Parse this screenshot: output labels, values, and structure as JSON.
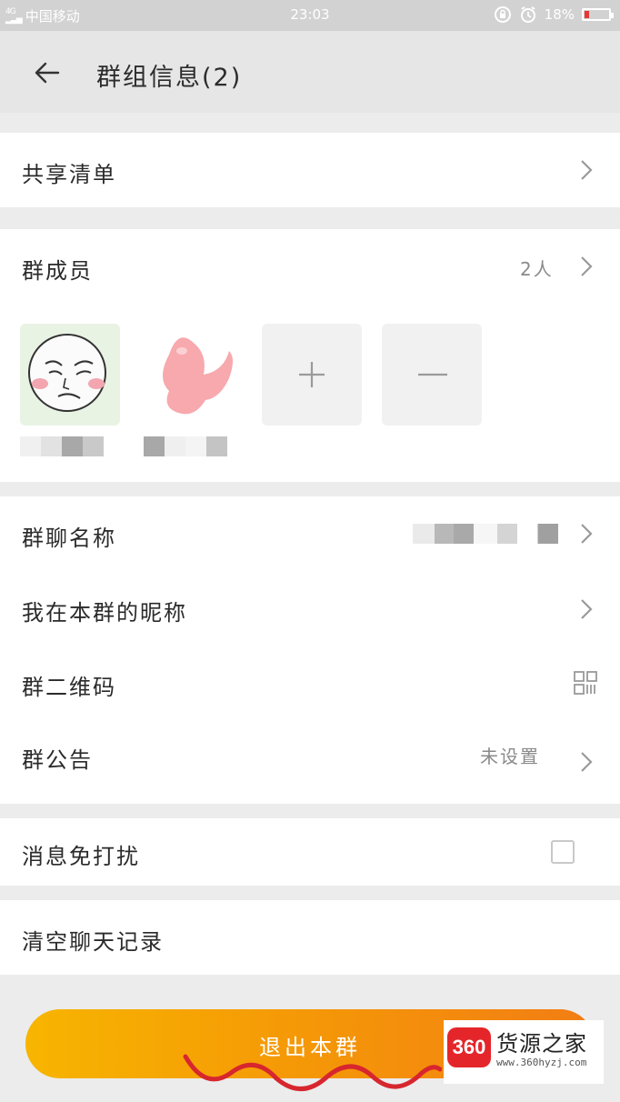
{
  "status_bar": {
    "carrier": "中国移动",
    "network": "4G",
    "time": "23:03",
    "battery": "18%",
    "battery_level": 0.18
  },
  "header": {
    "title": "群组信息(2)"
  },
  "sections": {
    "shared_list": {
      "label": "共享清单"
    },
    "members": {
      "label": "群成员",
      "count": "2人"
    },
    "group_name": {
      "label": "群聊名称"
    },
    "my_nickname": {
      "label": "我在本群的昵称"
    },
    "qr_code": {
      "label": "群二维码"
    },
    "announcement": {
      "label": "群公告",
      "value": "未设置"
    },
    "mute": {
      "label": "消息免打扰",
      "checked": false
    },
    "clear_history": {
      "label": "清空聊天记录"
    }
  },
  "member_actions": {
    "add": "+",
    "remove": "—"
  },
  "exit_button": {
    "label": "退出本群"
  },
  "watermark": {
    "logo": "360",
    "brand": "货源之家",
    "url": "www.360hyzj.com"
  },
  "colors": {
    "accent_start": "#f7b500",
    "accent_end": "#f27d14",
    "battery_low": "#e53935",
    "background": "#ececec"
  },
  "icons": {
    "back": "arrow-left-icon",
    "chevron": "chevron-right-icon",
    "qr": "qr-code-icon",
    "alarm": "alarm-icon",
    "lock": "lock-rotation-icon"
  }
}
